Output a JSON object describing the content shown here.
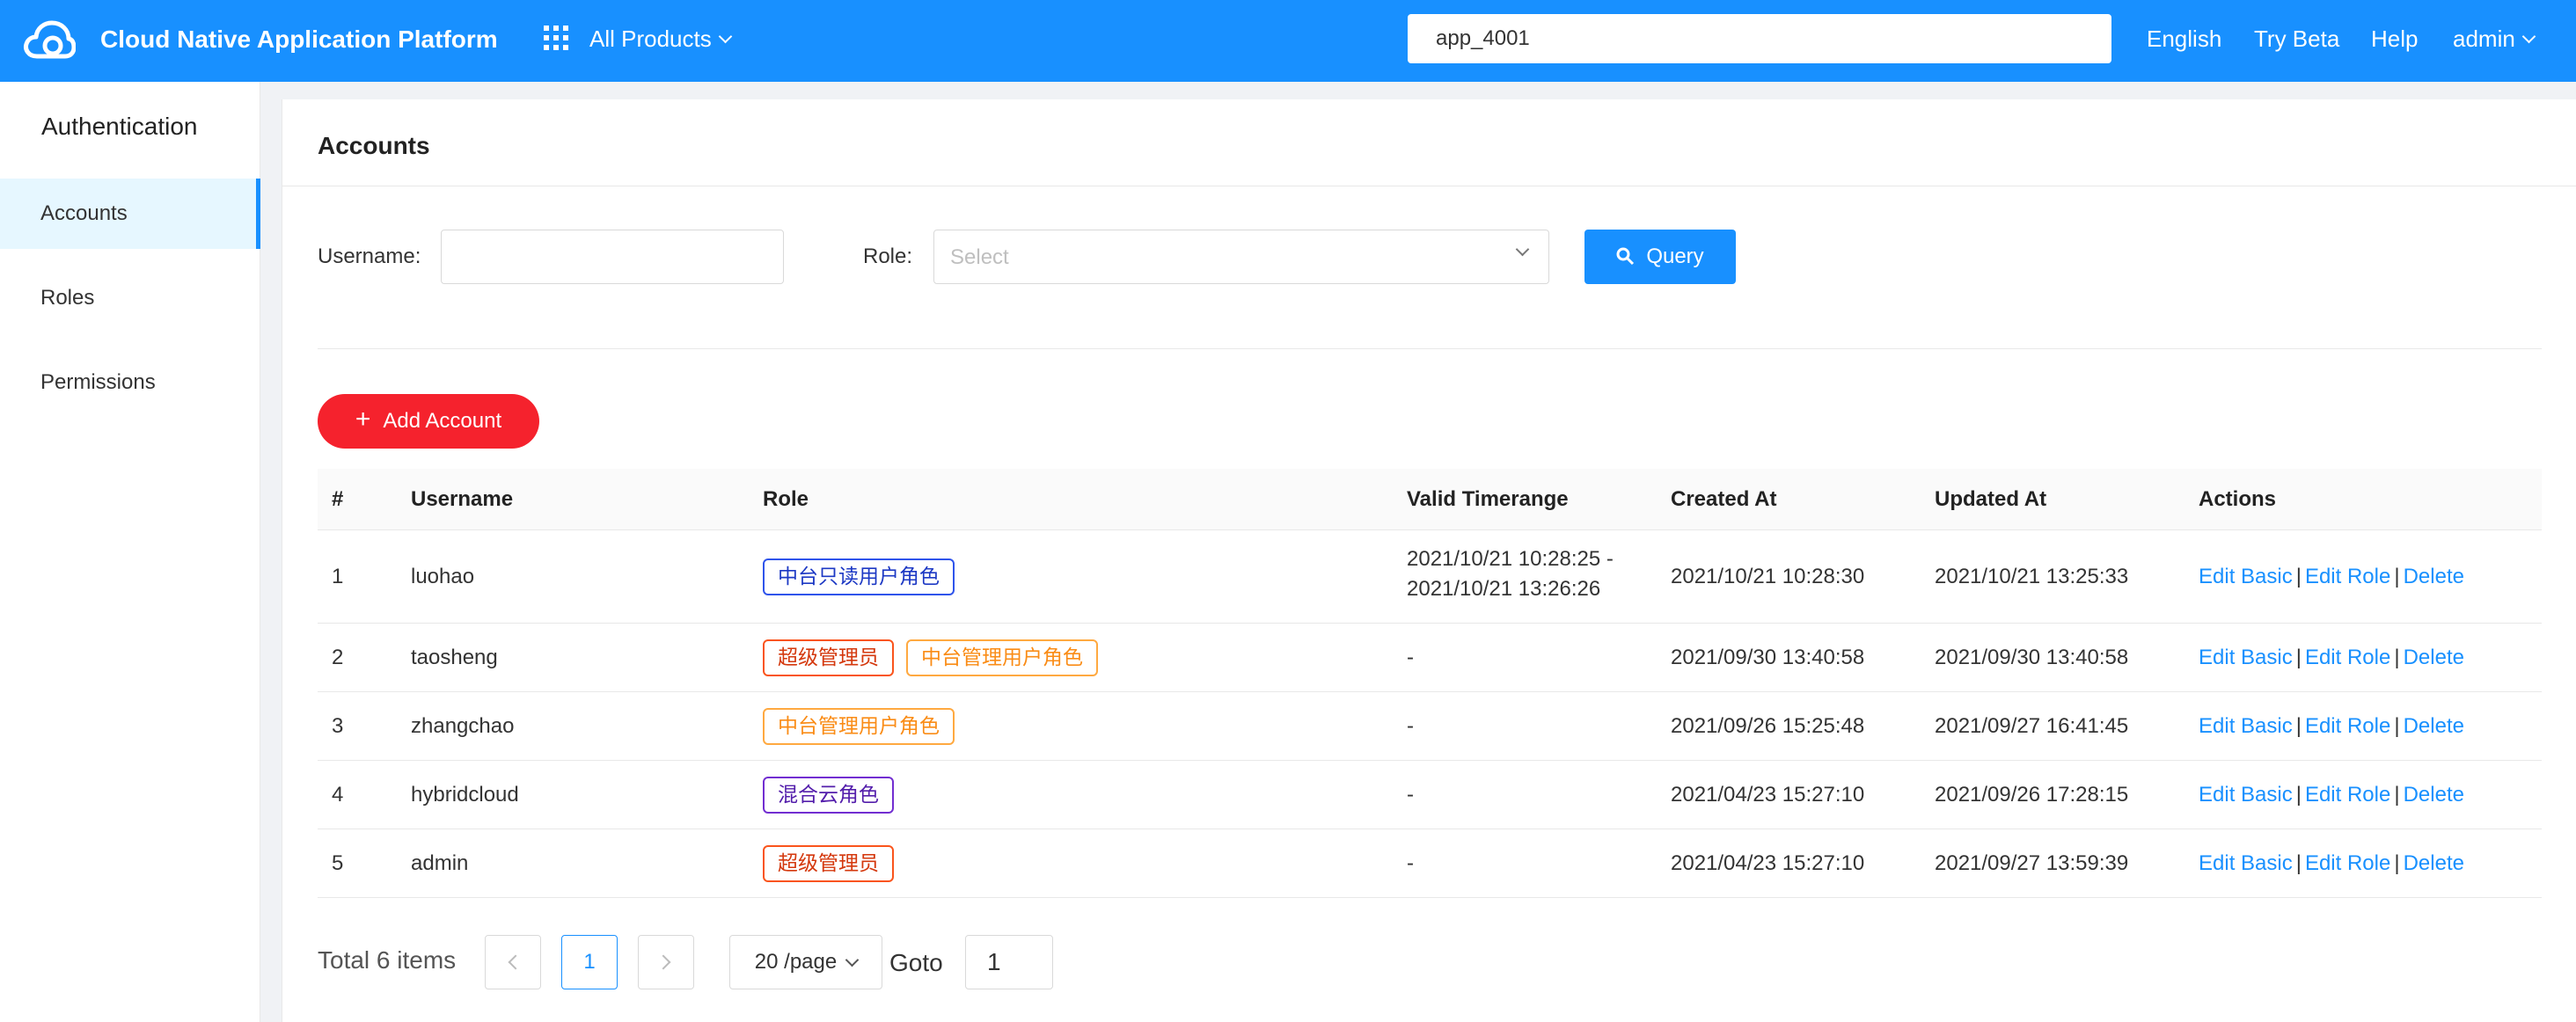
{
  "topbar": {
    "title": "Cloud Native Application Platform",
    "products_label": "All Products",
    "search_value": "app_4001",
    "language": "English",
    "try_beta": "Try Beta",
    "help": "Help",
    "user": "admin"
  },
  "sidebar": {
    "title": "Authentication",
    "items": [
      {
        "label": "Accounts",
        "active": true
      },
      {
        "label": "Roles",
        "active": false
      },
      {
        "label": "Permissions",
        "active": false
      }
    ]
  },
  "page": {
    "title": "Accounts",
    "filters": {
      "username_label": "Username:",
      "username_value": "",
      "role_label": "Role:",
      "role_placeholder": "Select",
      "query_button": "Query"
    },
    "add_button": "Add Account"
  },
  "table": {
    "columns": [
      "#",
      "Username",
      "Role",
      "Valid Timerange",
      "Created At",
      "Updated At",
      "Actions"
    ],
    "rows": [
      {
        "index": "1",
        "username": "luohao",
        "roles": [
          {
            "label": "中台只读用户角色",
            "color": "blue"
          }
        ],
        "timerange_start": "2021/10/21 10:28:25 -",
        "timerange_end": "2021/10/21 13:26:26",
        "created": "2021/10/21 10:28:30",
        "updated": "2021/10/21 13:25:33"
      },
      {
        "index": "2",
        "username": "taosheng",
        "roles": [
          {
            "label": "超级管理员",
            "color": "red"
          },
          {
            "label": "中台管理用户角色",
            "color": "orange"
          }
        ],
        "timerange_start": "-",
        "timerange_end": "",
        "created": "2021/09/30 13:40:58",
        "updated": "2021/09/30 13:40:58"
      },
      {
        "index": "3",
        "username": "zhangchao",
        "roles": [
          {
            "label": "中台管理用户角色",
            "color": "orange"
          }
        ],
        "timerange_start": "-",
        "timerange_end": "",
        "created": "2021/09/26 15:25:48",
        "updated": "2021/09/27 16:41:45"
      },
      {
        "index": "4",
        "username": "hybridcloud",
        "roles": [
          {
            "label": "混合云角色",
            "color": "purple"
          }
        ],
        "timerange_start": "-",
        "timerange_end": "",
        "created": "2021/04/23 15:27:10",
        "updated": "2021/09/26 17:28:15"
      },
      {
        "index": "5",
        "username": "admin",
        "roles": [
          {
            "label": "超级管理员",
            "color": "red"
          }
        ],
        "timerange_start": "-",
        "timerange_end": "",
        "created": "2021/04/23 15:27:10",
        "updated": "2021/09/27 13:59:39"
      }
    ],
    "actions": {
      "edit_basic": "Edit Basic",
      "edit_role": "Edit Role",
      "delete": "Delete",
      "separator": "|"
    }
  },
  "pagination": {
    "total": "Total 6 items",
    "current_page": "1",
    "page_size": "20 /page",
    "goto_label": "Goto",
    "goto_value": "1"
  },
  "colors": {
    "primary": "#1890ff",
    "danger": "#f5222d",
    "tag_blue": "#2f54eb",
    "tag_red": "#fa541c",
    "tag_orange": "#fa8c16",
    "tag_purple": "#722ed1"
  }
}
